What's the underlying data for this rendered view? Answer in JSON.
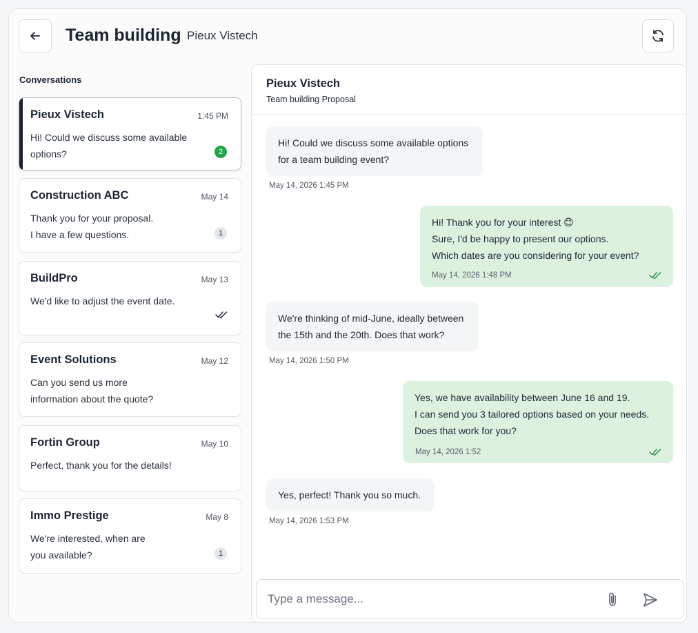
{
  "header": {
    "title": "Team building",
    "subtitle": "Pieux Vistech",
    "back_icon": "arrow-left-icon",
    "refresh_icon": "refresh-icon"
  },
  "sidebar": {
    "heading": "Conversations",
    "conversations": [
      {
        "name": "Pieux Vistech",
        "date": "1:45 PM",
        "preview": "Hi! Could we discuss some available options?",
        "status": "unread",
        "unread": "2",
        "active": true
      },
      {
        "name": "Construction ABC",
        "date": "May 14",
        "preview": "Thank you for your proposal. I have a few questions.",
        "status": "unread",
        "unread": "1"
      },
      {
        "name": "BuildPro",
        "date": "May 13",
        "preview": "We'd like to adjust the event date.",
        "status": "read"
      },
      {
        "name": "Event Solutions",
        "date": "May 12",
        "preview": "Can you send us more information about the quote?",
        "status": "none"
      },
      {
        "name": "Fortin Group",
        "date": "May 10",
        "preview": "Perfect, thank you for the details!",
        "status": "none"
      },
      {
        "name": "Immo Prestige",
        "date": "May 8",
        "preview": "We're interested, when are you available?",
        "status": "unread",
        "unread": "1"
      }
    ]
  },
  "chat": {
    "name": "Pieux Vistech",
    "topic": "Team building Proposal",
    "messages": [
      {
        "direction": "in",
        "text": "Hi! Could we discuss some available options for a team building event?",
        "time": "May 14, 2026 1:45 PM"
      },
      {
        "direction": "out",
        "lines": [
          "Hi! Thank you for your interest 😊",
          "Sure, I'd be happy to present our options.",
          "Which dates are you considering for your event?"
        ],
        "time": "May 14, 2026 1:48 PM"
      },
      {
        "direction": "in",
        "text": "We're thinking of mid-June, ideally between the 15th and the 20th. Does that work?",
        "time": "May 14, 2026 1:50 PM"
      },
      {
        "direction": "out",
        "lines": [
          "Yes, we have availability between June 16 and 19.",
          "I can send you 3 tailored options based on your needs.",
          "Does that work for you?"
        ],
        "time": "May 14, 2026 1:52"
      },
      {
        "direction": "in",
        "text": "Yes, perfect! Thank you so much.",
        "time": "May 14, 2026 1:53 PM"
      }
    ]
  },
  "composer": {
    "placeholder": "Type a message...",
    "attach_icon": "paperclip-icon",
    "send_icon": "send-icon"
  },
  "colors": {
    "accent": "#1c2433",
    "unread_badge": "#22a447",
    "outgoing_bubble": "#dcf1df",
    "incoming_bubble": "#f4f5f6",
    "read_check": "#2f8f4e"
  }
}
